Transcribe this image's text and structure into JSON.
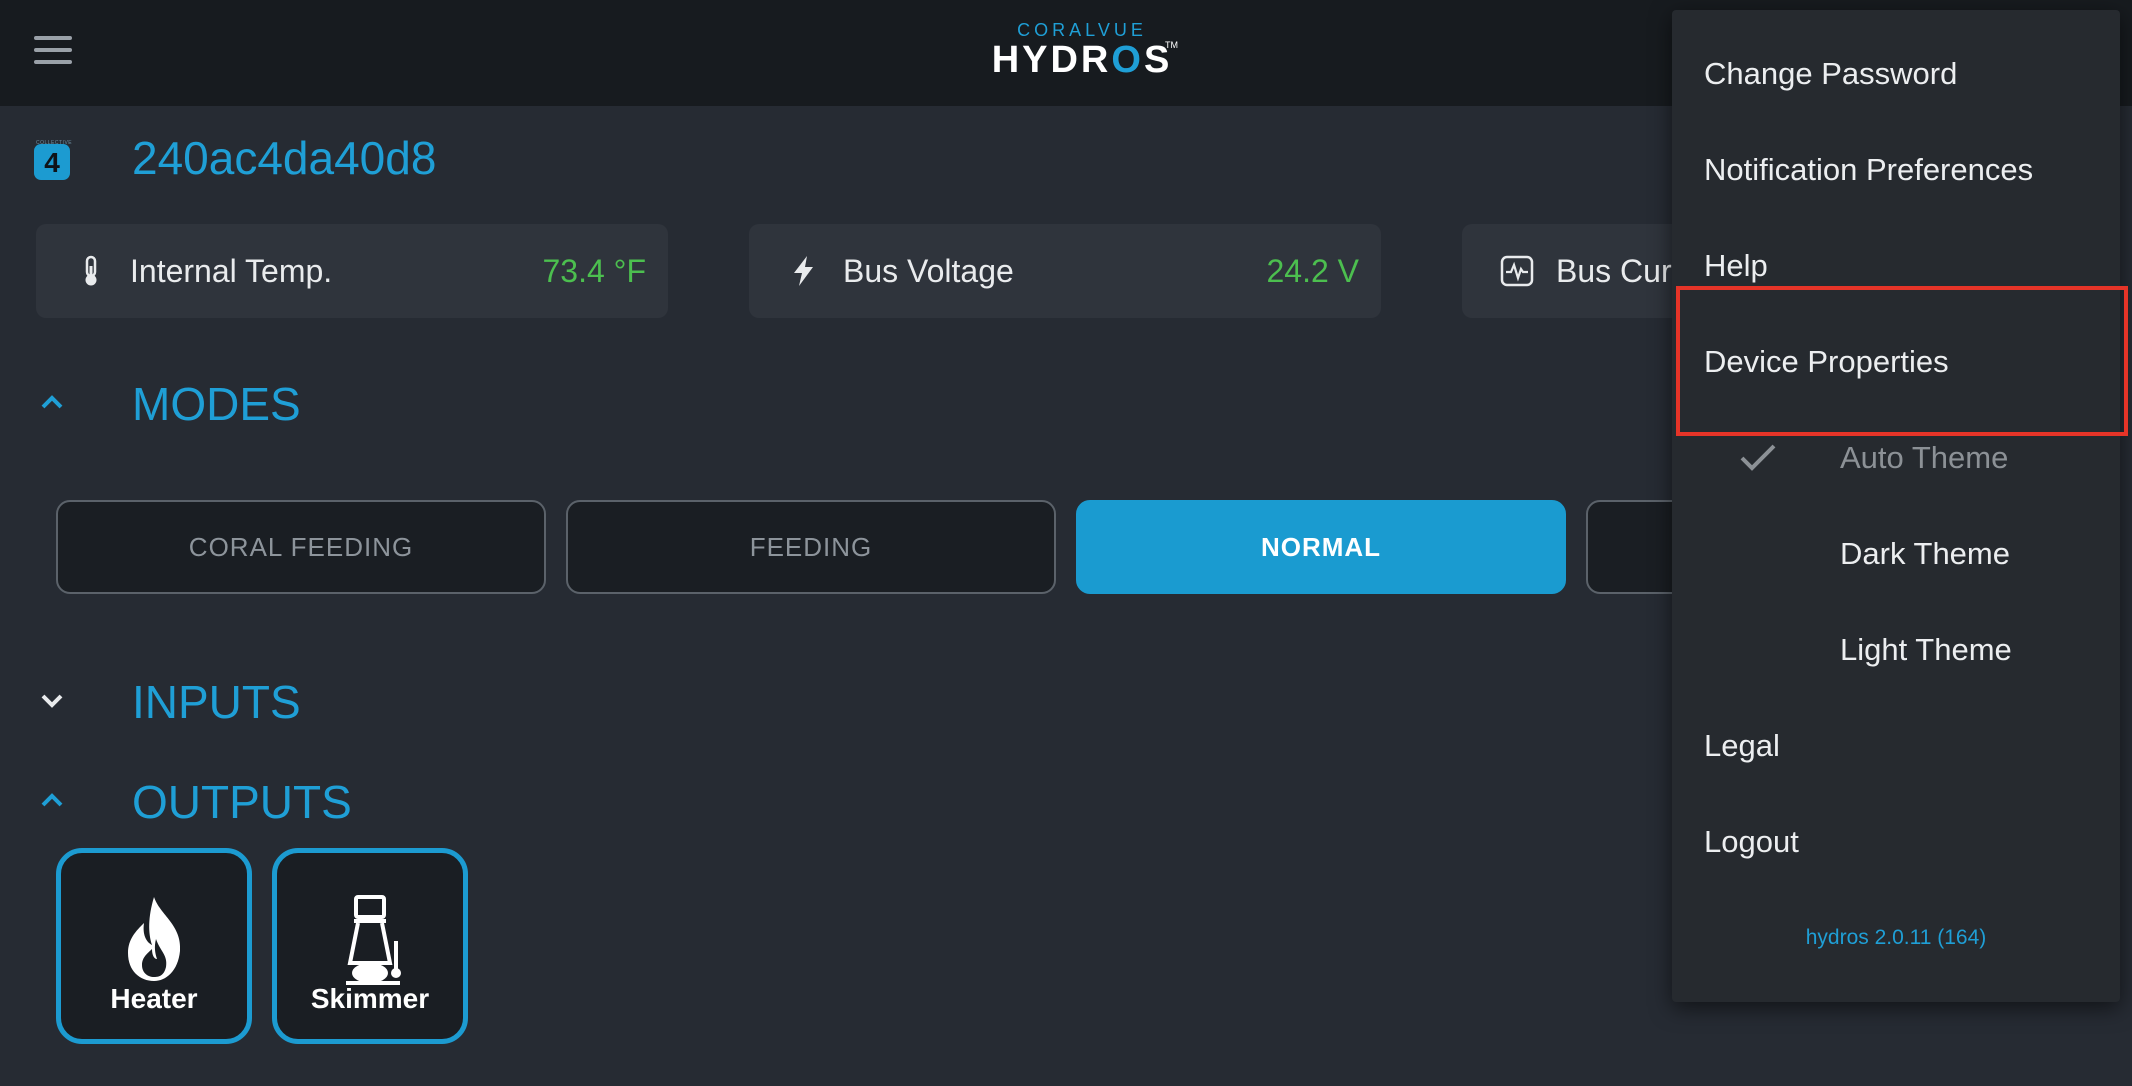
{
  "header": {
    "logo_top": "CORALVUE",
    "logo_main_1": "HYDR",
    "logo_main_o": "O",
    "logo_main_2": "S",
    "logo_tm": "TM"
  },
  "device": {
    "badge_small": "COLLECTIVE",
    "badge_number": "4",
    "title": "240ac4da40d8"
  },
  "stats": [
    {
      "label": "Internal Temp.",
      "value": "73.4 °F",
      "icon": "thermometer-icon"
    },
    {
      "label": "Bus Voltage",
      "value": "24.2 V",
      "icon": "lightning-icon"
    },
    {
      "label": "Bus Cur",
      "value": "",
      "icon": "pulse-monitor-icon"
    }
  ],
  "sections": {
    "modes": "MODES",
    "inputs": "INPUTS",
    "outputs": "OUTPUTS"
  },
  "modes": [
    {
      "label": "CORAL FEEDING",
      "active": false
    },
    {
      "label": "FEEDING",
      "active": false
    },
    {
      "label": "NORMAL",
      "active": true
    },
    {
      "label": "",
      "active": false
    }
  ],
  "outputs": [
    {
      "label": "Heater",
      "icon": "flame-icon"
    },
    {
      "label": "Skimmer",
      "icon": "skimmer-icon"
    }
  ],
  "menu": {
    "items": [
      {
        "label": "Change Password"
      },
      {
        "label": "Notification Preferences"
      },
      {
        "label": "Help"
      },
      {
        "label": "Device Properties"
      },
      {
        "label": "Auto Theme",
        "selected": true
      },
      {
        "label": "Dark Theme",
        "selected": false
      },
      {
        "label": "Light Theme",
        "selected": false
      },
      {
        "label": "Legal"
      },
      {
        "label": "Logout"
      }
    ],
    "version": "hydros 2.0.11 (164)"
  },
  "colors": {
    "accent": "#1f9fd6",
    "value_green": "#4cbf4f",
    "highlight_red": "#e63428",
    "background": "#262b33",
    "topbar": "#171b1f"
  }
}
